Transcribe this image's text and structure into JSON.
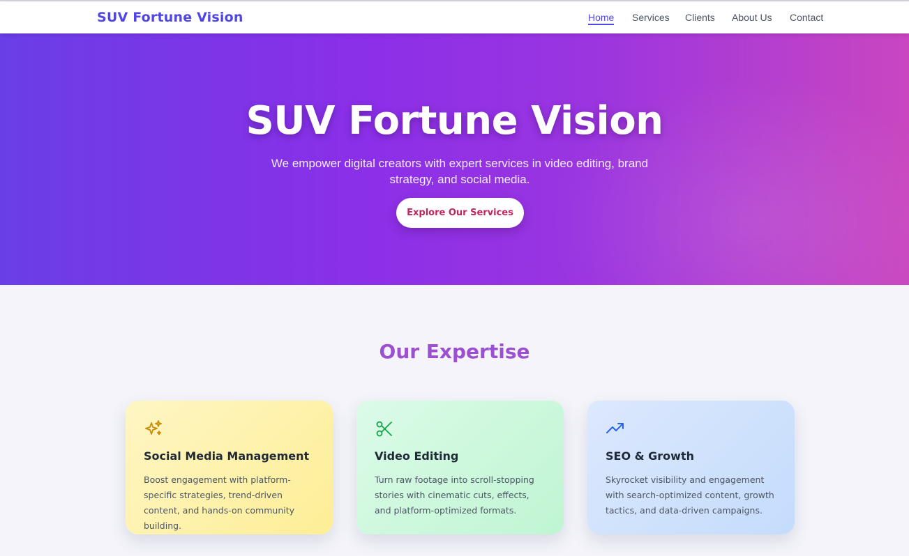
{
  "nav": {
    "brand": "SUV Fortune Vision",
    "links": [
      {
        "label": "Home",
        "active": true
      },
      {
        "label": "Services",
        "active": false
      },
      {
        "label": "Clients",
        "active": false
      },
      {
        "label": "About Us",
        "active": false
      },
      {
        "label": "Contact",
        "active": false
      }
    ]
  },
  "hero": {
    "title": "SUV Fortune Vision",
    "subtitle": "We empower digital creators with expert services in video editing, brand strategy, and social media.",
    "button_label": "Explore Our Services"
  },
  "expertise": {
    "title": "Our Expertise",
    "cards": [
      {
        "icon": "sparkles-icon",
        "title": "Social Media Management",
        "text": "Boost engagement with platform-specific strategies, trend-driven content, and hands-on community building."
      },
      {
        "icon": "scissors-icon",
        "title": "Video Editing",
        "text": "Turn raw footage into scroll-stopping stories with cinematic cuts, effects, and platform-optimized formats."
      },
      {
        "icon": "trending-up-icon",
        "title": "SEO & Growth",
        "text": "Skyrocket visibility and engagement with search-optimized content, growth tactics, and data-driven campaigns."
      }
    ]
  },
  "colors": {
    "brand": "#4f46e5",
    "hero_gradient_start": "#6a3ee6",
    "hero_gradient_end": "#c946c0",
    "section_title": "#9b4fd1",
    "button_text": "#c0265a"
  }
}
